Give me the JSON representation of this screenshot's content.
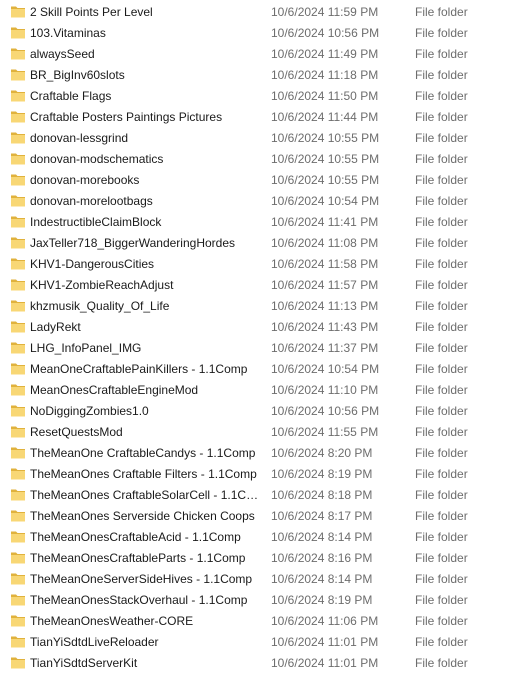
{
  "icons": {
    "folder": "folder-icon",
    "folder_color": "#f8d775",
    "folder_dark": "#e0b23d"
  },
  "rows": [
    {
      "name": "2 Skill Points Per Level",
      "date": "10/6/2024 11:59 PM",
      "type": "File folder"
    },
    {
      "name": "103.Vitaminas",
      "date": "10/6/2024 10:56 PM",
      "type": "File folder"
    },
    {
      "name": "alwaysSeed",
      "date": "10/6/2024 11:49 PM",
      "type": "File folder"
    },
    {
      "name": "BR_BigInv60slots",
      "date": "10/6/2024 11:18 PM",
      "type": "File folder"
    },
    {
      "name": "Craftable Flags",
      "date": "10/6/2024 11:50 PM",
      "type": "File folder"
    },
    {
      "name": "Craftable Posters Paintings Pictures",
      "date": "10/6/2024 11:44 PM",
      "type": "File folder"
    },
    {
      "name": "donovan-lessgrind",
      "date": "10/6/2024 10:55 PM",
      "type": "File folder"
    },
    {
      "name": "donovan-modschematics",
      "date": "10/6/2024 10:55 PM",
      "type": "File folder"
    },
    {
      "name": "donovan-morebooks",
      "date": "10/6/2024 10:55 PM",
      "type": "File folder"
    },
    {
      "name": "donovan-morelootbags",
      "date": "10/6/2024 10:54 PM",
      "type": "File folder"
    },
    {
      "name": "IndestructibleClaimBlock",
      "date": "10/6/2024 11:41 PM",
      "type": "File folder"
    },
    {
      "name": "JaxTeller718_BiggerWanderingHordes",
      "date": "10/6/2024 11:08 PM",
      "type": "File folder"
    },
    {
      "name": "KHV1-DangerousCities",
      "date": "10/6/2024 11:58 PM",
      "type": "File folder"
    },
    {
      "name": "KHV1-ZombieReachAdjust",
      "date": "10/6/2024 11:57 PM",
      "type": "File folder"
    },
    {
      "name": "khzmusik_Quality_Of_Life",
      "date": "10/6/2024 11:13 PM",
      "type": "File folder"
    },
    {
      "name": "LadyRekt",
      "date": "10/6/2024 11:43 PM",
      "type": "File folder"
    },
    {
      "name": "LHG_InfoPanel_IMG",
      "date": "10/6/2024 11:37 PM",
      "type": "File folder"
    },
    {
      "name": "MeanOneCraftablePainKillers - 1.1Comp",
      "date": "10/6/2024 10:54 PM",
      "type": "File folder"
    },
    {
      "name": "MeanOnesCraftableEngineMod",
      "date": "10/6/2024 11:10 PM",
      "type": "File folder"
    },
    {
      "name": "NoDiggingZombies1.0",
      "date": "10/6/2024 10:56 PM",
      "type": "File folder"
    },
    {
      "name": "ResetQuestsMod",
      "date": "10/6/2024 11:55 PM",
      "type": "File folder"
    },
    {
      "name": "TheMeanOne CraftableCandys - 1.1Comp",
      "date": "10/6/2024 8:20 PM",
      "type": "File folder"
    },
    {
      "name": "TheMeanOnes Craftable Filters - 1.1Comp",
      "date": "10/6/2024 8:19 PM",
      "type": "File folder"
    },
    {
      "name": "TheMeanOnes CraftableSolarCell - 1.1Co...",
      "date": "10/6/2024 8:18 PM",
      "type": "File folder"
    },
    {
      "name": "TheMeanOnes Serverside Chicken Coops",
      "date": "10/6/2024 8:17 PM",
      "type": "File folder"
    },
    {
      "name": "TheMeanOnesCraftableAcid - 1.1Comp",
      "date": "10/6/2024 8:14 PM",
      "type": "File folder"
    },
    {
      "name": "TheMeanOnesCraftableParts - 1.1Comp",
      "date": "10/6/2024 8:16 PM",
      "type": "File folder"
    },
    {
      "name": "TheMeanOneServerSideHives - 1.1Comp",
      "date": "10/6/2024 8:14 PM",
      "type": "File folder"
    },
    {
      "name": "TheMeanOnesStackOverhaul - 1.1Comp",
      "date": "10/6/2024 8:19 PM",
      "type": "File folder"
    },
    {
      "name": "TheMeanOnesWeather-CORE",
      "date": "10/6/2024 11:06 PM",
      "type": "File folder"
    },
    {
      "name": "TianYiSdtdLiveReloader",
      "date": "10/6/2024 11:01 PM",
      "type": "File folder"
    },
    {
      "name": "TianYiSdtdServerKit",
      "date": "10/6/2024 11:01 PM",
      "type": "File folder"
    }
  ]
}
